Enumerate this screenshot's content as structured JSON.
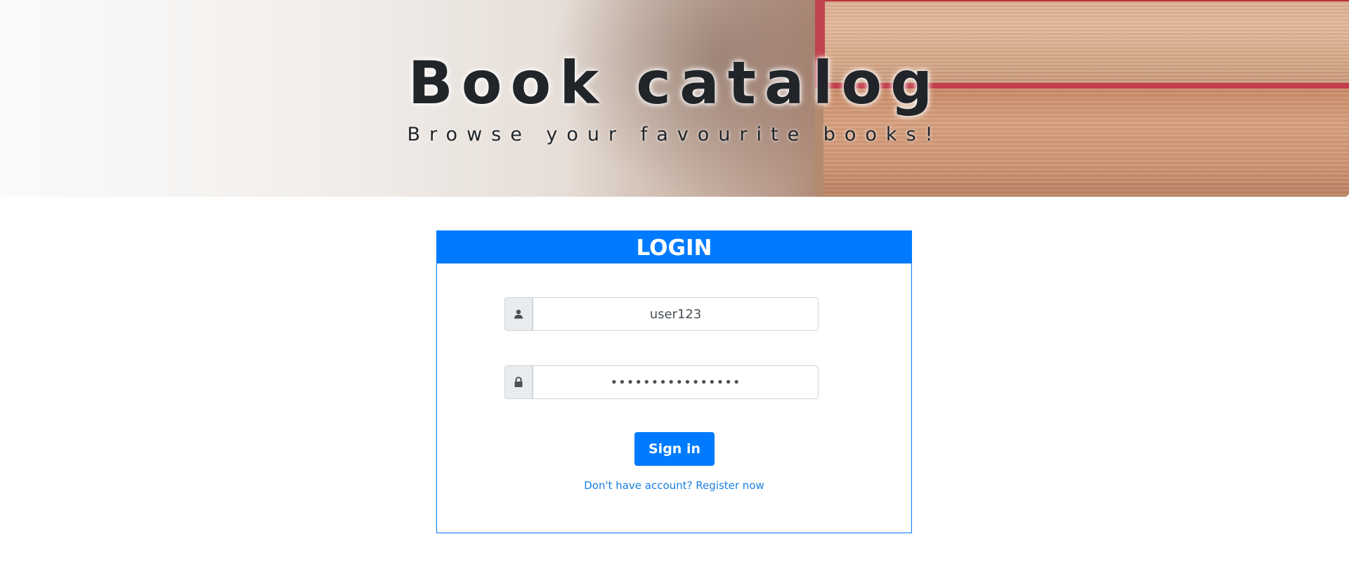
{
  "banner": {
    "title": "Book catalog",
    "subtitle": "Browse your favourite books!"
  },
  "login": {
    "header": "LOGIN",
    "username": {
      "value": "user123",
      "icon": "user-icon"
    },
    "password": {
      "value": "••••••••••••••••",
      "icon": "lock-icon"
    },
    "signin_label": "Sign in",
    "register_text": "Don't have account? Register now"
  },
  "colors": {
    "primary": "#007bff",
    "addon_bg": "#e9ecef",
    "border": "#ced4da",
    "text_dark": "#212529"
  }
}
